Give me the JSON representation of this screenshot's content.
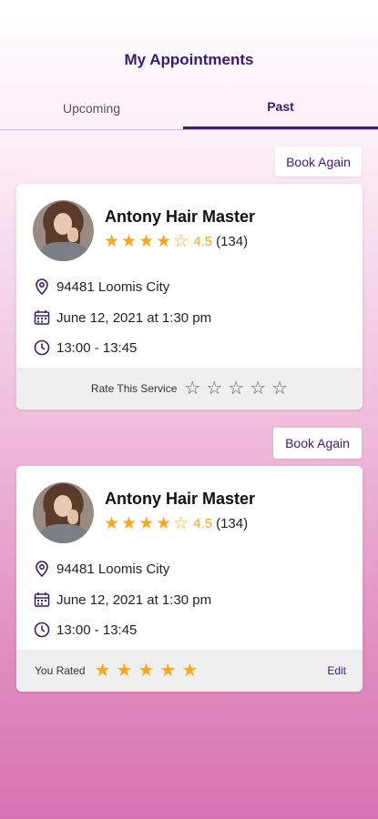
{
  "header": {
    "title": "My Appointments"
  },
  "tabs": [
    {
      "label": "Upcoming",
      "active": false
    },
    {
      "label": "Past",
      "active": true
    }
  ],
  "accent_color": "#3c1a6e",
  "star_color": "#f5a623",
  "appointments": [
    {
      "book_again_label": "Book Again",
      "name": "Antony Hair Master",
      "rating_stars": 4,
      "rating_score": "4.5",
      "rating_count": "(134)",
      "location": "94481 Loomis City",
      "date": "June 12, 2021 at 1:30 pm",
      "time": "13:00 - 13:45",
      "footer_label": "Rate This Service",
      "user_rating": 0
    },
    {
      "book_again_label": "Book Again",
      "name": "Antony Hair Master",
      "rating_stars": 4,
      "rating_score": "4.5",
      "rating_count": "(134)",
      "location": "94481 Loomis City",
      "date": "June 12, 2021 at 1:30 pm",
      "time": "13:00 - 13:45",
      "footer_label": "You Rated",
      "user_rating": 5,
      "edit_label": "Edit"
    }
  ]
}
